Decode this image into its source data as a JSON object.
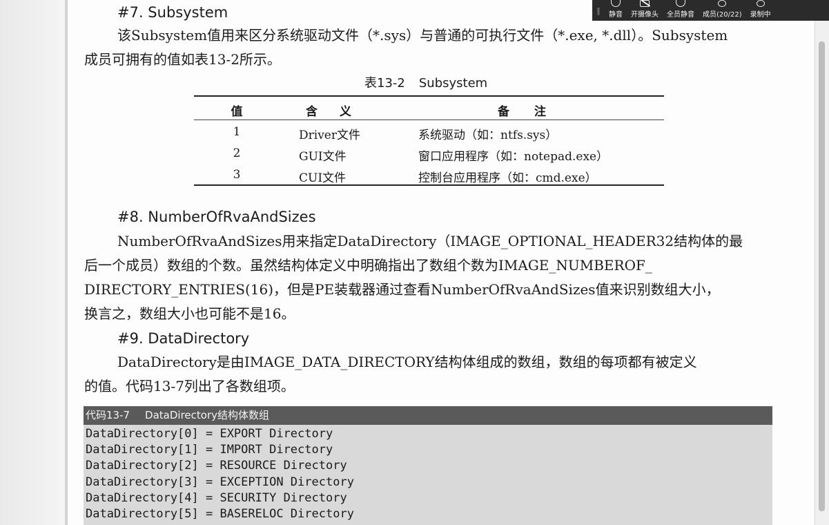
{
  "toolbar": {
    "items": [
      {
        "label": "静音",
        "icon": "microphone-icon"
      },
      {
        "label": "开摄像头",
        "icon": "camera-off-icon"
      },
      {
        "label": "全员静音",
        "icon": "mute-all-icon"
      },
      {
        "label": "成员(20/22)",
        "icon": "members-icon"
      },
      {
        "label": "录制中",
        "icon": "record-icon"
      }
    ]
  },
  "section7": {
    "heading": "#7. Subsystem",
    "lines": [
      "该Subsystem值用来区分系统驱动文件（*.sys）与普通的可执行文件（*.exe, *.dll）。Subsystem",
      "成员可拥有的值如表13-2所示。"
    ]
  },
  "table": {
    "caption_num": "表13-2",
    "caption_text": "Subsystem",
    "headers": [
      "值",
      "含义",
      "备注"
    ],
    "rows": [
      [
        "1",
        "Driver文件",
        "系统驱动（如：ntfs.sys）"
      ],
      [
        "2",
        "GUI文件",
        "窗口应用程序（如：notepad.exe）"
      ],
      [
        "3",
        "CUI文件",
        "控制台应用程序（如：cmd.exe）"
      ]
    ]
  },
  "section8": {
    "heading": "#8. NumberOfRvaAndSizes",
    "lines": [
      "NumberOfRvaAndSizes用来指定DataDirectory（IMAGE_OPTIONAL_HEADER32结构体的最",
      "后一个成员）数组的个数。虽然结构体定义中明确指出了数组个数为IMAGE_NUMBEROF_",
      "DIRECTORY_ENTRIES(16)，但是PE装载器通过查看NumberOfRvaAndSizes值来识别数组大小，",
      "换言之，数组大小也可能不是16。"
    ]
  },
  "section9": {
    "heading": "#9. DataDirectory",
    "lines": [
      "DataDirectory是由IMAGE_DATA_DIRECTORY结构体组成的数组，数组的每项都有被定义",
      "的值。代码13-7列出了各数组项。"
    ]
  },
  "code": {
    "title_num": "代码13-7",
    "title_text": "DataDirectory结构体数组",
    "lines": [
      "DataDirectory[0] = EXPORT Directory",
      "DataDirectory[1] = IMPORT Directory",
      "DataDirectory[2] = RESOURCE Directory",
      "DataDirectory[3] = EXCEPTION Directory",
      "DataDirectory[4] = SECURITY Directory",
      "DataDirectory[5] = BASERELOC Directory"
    ]
  }
}
